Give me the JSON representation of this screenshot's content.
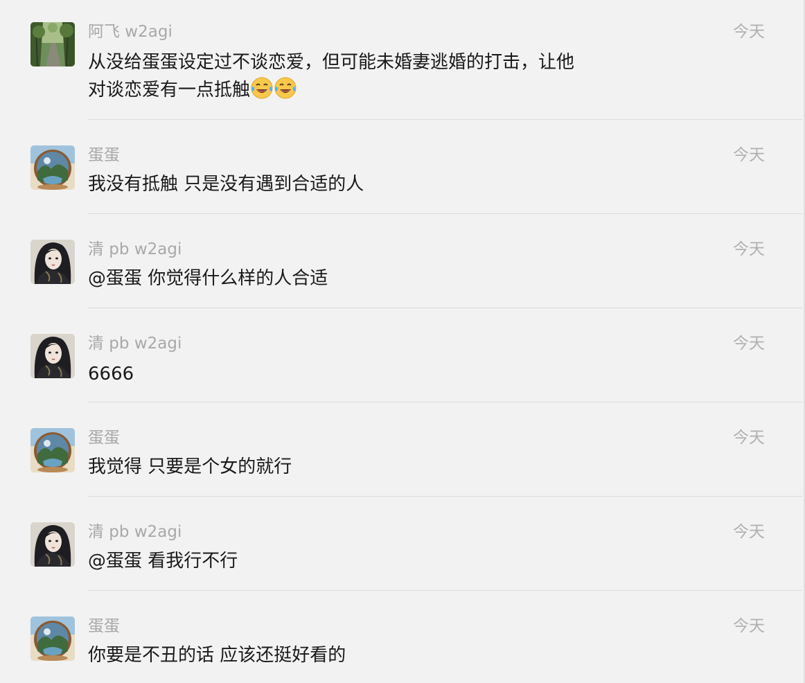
{
  "messages": [
    {
      "sender": "阿飞 w2agi",
      "time": "今天",
      "text": "从没给蛋蛋设定过不谈恋爱，但可能未婚妻逃婚的打击，让他\n对谈恋爱有一点抵触",
      "emoji": [
        "face-with-tears-of-joy",
        "face-with-tears-of-joy"
      ],
      "avatar": "forest-path"
    },
    {
      "sender": "蛋蛋",
      "time": "今天",
      "text": "我没有抵触 只是没有遇到合适的人",
      "avatar": "egg-landscape"
    },
    {
      "sender": "清 pb w2agi",
      "time": "今天",
      "text": "@蛋蛋 你觉得什么样的人合适",
      "avatar": "dark-hair-portrait"
    },
    {
      "sender": "清 pb w2agi",
      "time": "今天",
      "text": "6666",
      "avatar": "dark-hair-portrait"
    },
    {
      "sender": "蛋蛋",
      "time": "今天",
      "text": "我觉得 只要是个女的就行",
      "avatar": "egg-landscape"
    },
    {
      "sender": "清 pb w2agi",
      "time": "今天",
      "text": "@蛋蛋 看我行不行",
      "avatar": "dark-hair-portrait"
    },
    {
      "sender": "蛋蛋",
      "time": "今天",
      "text": "你要是不丑的话 应该还挺好看的",
      "avatar": "egg-landscape"
    }
  ],
  "colors": {
    "background": "#f2f2f2",
    "sender": "#a8a8a8",
    "time": "#b0b0b0",
    "text": "#191919",
    "divider": "#dcdcdc"
  }
}
